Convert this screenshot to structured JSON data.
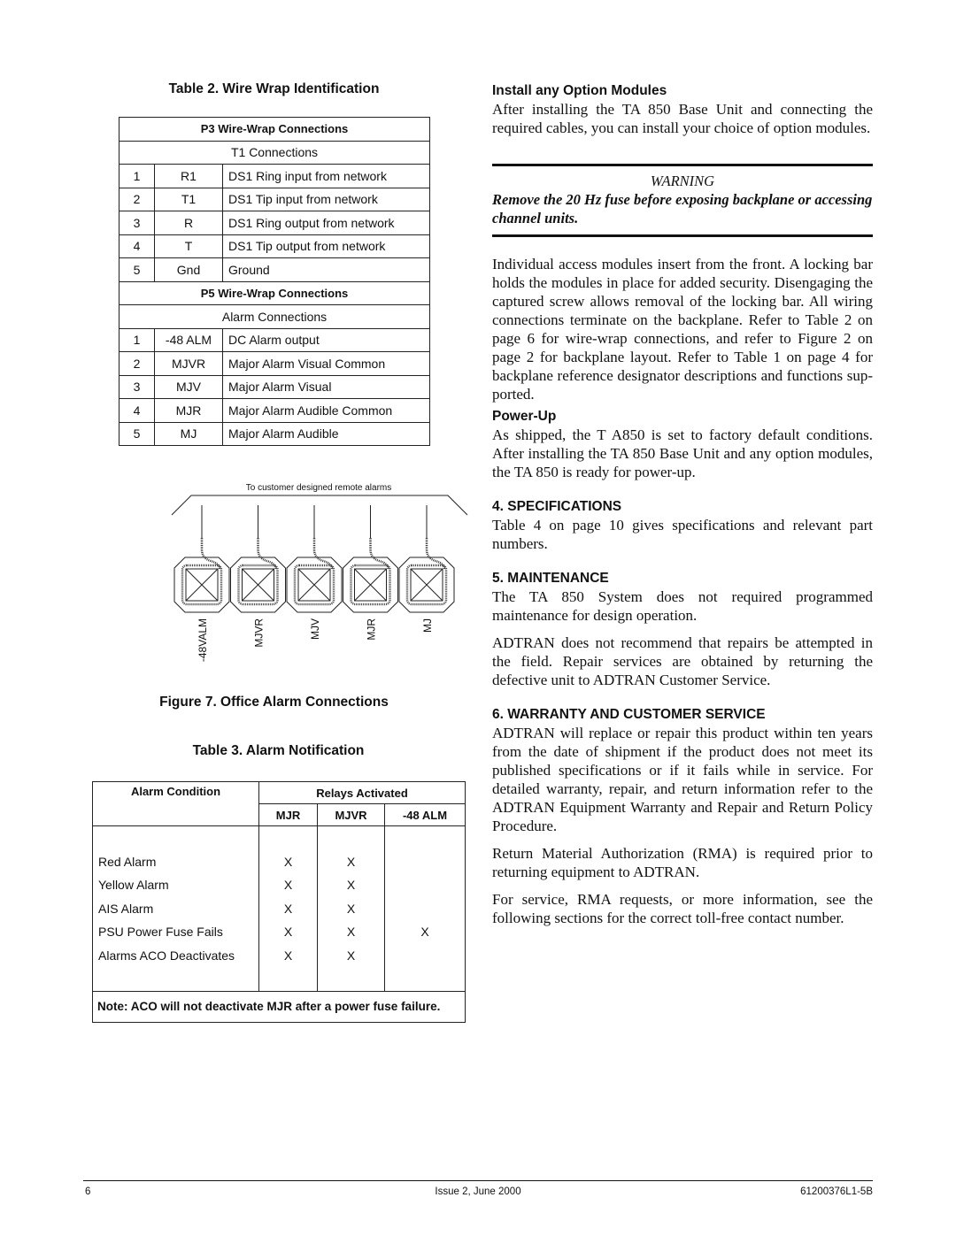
{
  "table2": {
    "caption": "Table 2.  Wire Wrap Identification",
    "p3_header": "P3 Wire-Wrap Connections",
    "p3_sub": "T1 Connections",
    "p3_rows": [
      {
        "num": "1",
        "pin": "R1",
        "desc": "DS1 Ring input from network"
      },
      {
        "num": "2",
        "pin": "T1",
        "desc": "DS1 Tip input from network"
      },
      {
        "num": "3",
        "pin": "R",
        "desc": "DS1 Ring output from network"
      },
      {
        "num": "4",
        "pin": "T",
        "desc": "DS1 Tip output from network"
      },
      {
        "num": "5",
        "pin": "Gnd",
        "desc": "Ground"
      }
    ],
    "p5_header": "P5 Wire-Wrap Connections",
    "p5_sub": "Alarm Connections",
    "p5_rows": [
      {
        "num": "1",
        "pin": "-48 ALM",
        "desc": "DC Alarm output"
      },
      {
        "num": "2",
        "pin": "MJVR",
        "desc": "Major Alarm Visual Common"
      },
      {
        "num": "3",
        "pin": "MJV",
        "desc": "Major Alarm Visual"
      },
      {
        "num": "4",
        "pin": "MJR",
        "desc": "Major Alarm Audible Common"
      },
      {
        "num": "5",
        "pin": "MJ",
        "desc": "Major Alarm Audible"
      }
    ]
  },
  "figure7": {
    "top_label": "To customer designed remote alarms",
    "terminals": [
      "-48VALM",
      "MJVR",
      "MJV",
      "MJR",
      "MJ"
    ],
    "caption": "Figure 7.  Office Alarm Connections"
  },
  "table3": {
    "caption": "Table 3.  Alarm Notification",
    "col_condition": "Alarm Condition",
    "col_relays": "Relays Activated",
    "relay_cols": [
      "MJR",
      "MJVR",
      "-48 ALM"
    ],
    "rows": [
      {
        "condition": "Red Alarm",
        "mjr": "X",
        "mjvr": "X",
        "alm": ""
      },
      {
        "condition": "Yellow Alarm",
        "mjr": "X",
        "mjvr": "X",
        "alm": ""
      },
      {
        "condition": "AIS Alarm",
        "mjr": "X",
        "mjvr": "X",
        "alm": ""
      },
      {
        "condition": "PSU Power Fuse Fails",
        "mjr": "X",
        "mjvr": "X",
        "alm": "X"
      },
      {
        "condition": "Alarms ACO Deactivates",
        "mjr": "X",
        "mjvr": "X",
        "alm": ""
      }
    ],
    "note": "Note: ACO will not deactivate MJR after a power fuse failure."
  },
  "right": {
    "install_heading": "Install any Option Modules",
    "install_text": "After installing the TA 850 Base Unit and connecting the required cables, you can install your choice of op­tion modules.",
    "warning_title": "WARNING",
    "warning_text": "Remove the 20 Hz fuse before exposing backplane or accessing channel units.",
    "modules_text": "Individual access modules insert from the front. A lock­ing bar holds the modules in place for added security. Disengaging the captured screw allows removal of the locking bar. All wiring connections terminate on the backplane. Refer to Table 2 on page 6 for wire-wrap connections, and refer to Figure 2 on page 2 for back­plane layout. Refer to Table 1 on page 4 for backplane reference designator descriptions and functions sup­ported.",
    "powerup_heading": "Power-Up",
    "powerup_text": "As shipped, the T A850 is set to factory default condi­tions. After installing the TA 850 Base Unit and any op­tion modules, the TA 850 is ready for power-up.",
    "spec_heading": "4.   SPECIFICATIONS",
    "spec_text": "Table 4 on page 10 gives specifications and relevant part numbers.",
    "maint_heading": "5.   MAINTENANCE",
    "maint_text1": "The TA 850 System does not required programmed maintenance for design operation.",
    "maint_text2": "ADTRAN does not recommend that repairs be attempt­ed in the field. Repair services are obtained by returning the defective unit to ADTRAN Customer Service.",
    "warranty_heading": "6.   WARRANTY AND CUSTOMER SERVICE",
    "warranty_text1": "ADTRAN will replace or repair this product within ten years from the date of shipment if the product does not meet its published specifications or if it fails while in service. For detailed warranty, repair, and return infor­mation refer to the ADTRAN Equipment Warranty and Repair and Return Policy Procedure.",
    "warranty_text2": "Return Material Authorization (RMA) is required prior to returning equipment to ADTRAN.",
    "warranty_text3": "For service, RMA requests, or more information, see the following sections for the correct toll-free contact num­ber."
  },
  "footer": {
    "page_number": "6",
    "issue": "Issue 2, June 2000",
    "doc_number": "61200376L1-5B"
  }
}
